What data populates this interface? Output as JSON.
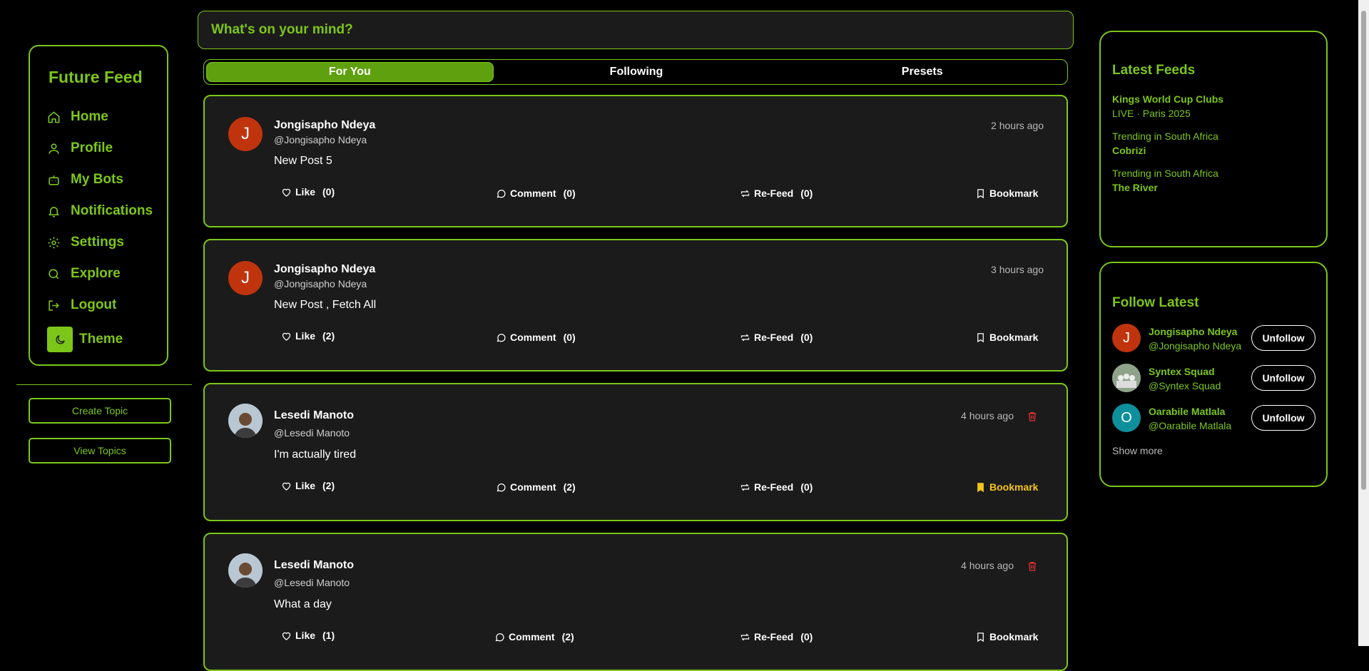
{
  "sidebar": {
    "brand": "Future Feed",
    "items": [
      {
        "label": "Home",
        "icon": "home-icon"
      },
      {
        "label": "Profile",
        "icon": "user-icon"
      },
      {
        "label": "My Bots",
        "icon": "bot-icon"
      },
      {
        "label": "Notifications",
        "icon": "bell-icon"
      },
      {
        "label": "Settings",
        "icon": "gear-icon"
      },
      {
        "label": "Explore",
        "icon": "search-icon"
      },
      {
        "label": "Logout",
        "icon": "logout-icon"
      },
      {
        "label": "Theme",
        "icon": "moon-icon"
      }
    ],
    "create_topic": "Create Topic",
    "view_topics": "View Topics"
  },
  "composer": {
    "placeholder": "What's on your mind?"
  },
  "tabs": [
    {
      "label": "For You",
      "active": true
    },
    {
      "label": "Following",
      "active": false
    },
    {
      "label": "Presets",
      "active": false
    }
  ],
  "posts": [
    {
      "author": "Jongisapho Ndeya",
      "handle": "@Jongisapho Ndeya",
      "avatar_letter": "J",
      "time": "2 hours ago",
      "content": "New Post 5",
      "like": "Like",
      "likes": "(0)",
      "comment": "Comment",
      "comments": "(0)",
      "refeed": "Re-Feed",
      "refeeds": "(0)",
      "bookmark": "Bookmark",
      "bookmarked": false,
      "deletable": false
    },
    {
      "author": "Jongisapho Ndeya",
      "handle": "@Jongisapho Ndeya",
      "avatar_letter": "J",
      "time": "3 hours ago",
      "content": "New Post , Fetch All",
      "like": "Like",
      "likes": "(2)",
      "comment": "Comment",
      "comments": "(0)",
      "refeed": "Re-Feed",
      "refeeds": "(0)",
      "bookmark": "Bookmark",
      "bookmarked": false,
      "deletable": false
    },
    {
      "author": "Lesedi Manoto",
      "handle": "@Lesedi Manoto",
      "avatar_letter": "",
      "time": "4 hours ago",
      "content": "I'm actually tired",
      "like": "Like",
      "likes": "(2)",
      "comment": "Comment",
      "comments": "(2)",
      "refeed": "Re-Feed",
      "refeeds": "(0)",
      "bookmark": "Bookmark",
      "bookmarked": true,
      "deletable": true
    },
    {
      "author": "Lesedi Manoto",
      "handle": "@Lesedi Manoto",
      "avatar_letter": "",
      "time": "4 hours ago",
      "content": "What a day",
      "like": "Like",
      "likes": "(1)",
      "comment": "Comment",
      "comments": "(2)",
      "refeed": "Re-Feed",
      "refeeds": "(0)",
      "bookmark": "Bookmark",
      "bookmarked": false,
      "deletable": true
    }
  ],
  "latest_feeds": {
    "title": "Latest Feeds",
    "items": [
      {
        "line1": "Kings World Cup Clubs",
        "line2": "LIVE · Paris 2025"
      },
      {
        "line1": "Trending in South Africa",
        "line2": "Cobrizi"
      },
      {
        "line1": "Trending in South Africa",
        "line2": "The River"
      }
    ]
  },
  "follow_latest": {
    "title": "Follow Latest",
    "items": [
      {
        "name": "Jongisapho Ndeya",
        "handle": "@Jongisapho Ndeya",
        "avatar_letter": "J",
        "avatar_color": "#c0340d",
        "button": "Unfollow"
      },
      {
        "name": "Syntex Squad",
        "handle": "@Syntex Squad",
        "avatar_letter": "",
        "avatar_color": "#6c7a6a",
        "button": "Unfollow"
      },
      {
        "name": "Oarabile Matlala",
        "handle": "@Oarabile Matlala",
        "avatar_letter": "O",
        "avatar_color": "#0e8f9c",
        "button": "Unfollow"
      }
    ],
    "show_more": "Show more"
  },
  "colors": {
    "accent": "#7cc61a",
    "bookmark_active": "#f5c518",
    "delete": "#e03131"
  }
}
